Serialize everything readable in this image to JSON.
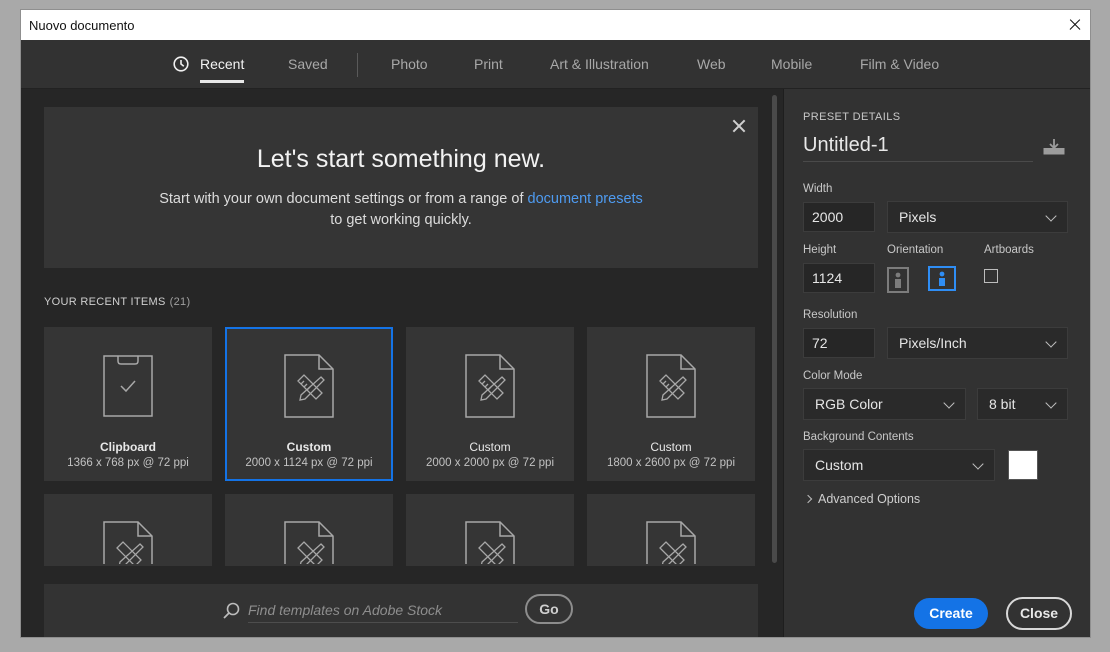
{
  "window": {
    "title": "Nuovo documento"
  },
  "tabs": [
    {
      "label": "Recent"
    },
    {
      "label": "Saved"
    },
    {
      "label": "Photo"
    },
    {
      "label": "Print"
    },
    {
      "label": "Art & Illustration"
    },
    {
      "label": "Web"
    },
    {
      "label": "Mobile"
    },
    {
      "label": "Film & Video"
    }
  ],
  "hero": {
    "heading": "Let's start something new.",
    "text_before": "Start with your own document settings or from a range of ",
    "link": "document presets",
    "text_after": "to get working quickly."
  },
  "recent": {
    "title": "YOUR RECENT ITEMS",
    "count": "(21)",
    "items": [
      {
        "name": "Clipboard",
        "desc": "1366 x 768 px @ 72 ppi",
        "icon": "clipboard-icon"
      },
      {
        "name": "Custom",
        "desc": "2000 x 1124 px @ 72 ppi",
        "icon": "document-ruler-pencil-icon",
        "selected": true
      },
      {
        "name": "Custom",
        "desc": "2000 x 2000 px @ 72 ppi",
        "icon": "document-ruler-pencil-icon"
      },
      {
        "name": "Custom",
        "desc": "1800 x 2600 px @ 72 ppi",
        "icon": "document-ruler-pencil-icon"
      }
    ]
  },
  "search": {
    "placeholder": "Find templates on Adobe Stock",
    "go_label": "Go"
  },
  "preset": {
    "section_title": "PRESET DETAILS",
    "doc_name": "Untitled-1",
    "width_label": "Width",
    "width_value": "2000",
    "width_unit": "Pixels",
    "height_label": "Height",
    "height_value": "1124",
    "orientation_label": "Orientation",
    "artboards_label": "Artboards",
    "resolution_label": "Resolution",
    "resolution_value": "72",
    "resolution_unit": "Pixels/Inch",
    "color_mode_label": "Color Mode",
    "color_mode_value": "RGB Color",
    "bit_depth": "8 bit",
    "bg_label": "Background Contents",
    "bg_value": "Custom",
    "bg_color": "#ffffff",
    "advanced_label": "Advanced Options"
  },
  "actions": {
    "create_label": "Create",
    "close_label": "Close"
  },
  "colors": {
    "accent": "#1473e6",
    "link": "#4e9bf1"
  }
}
